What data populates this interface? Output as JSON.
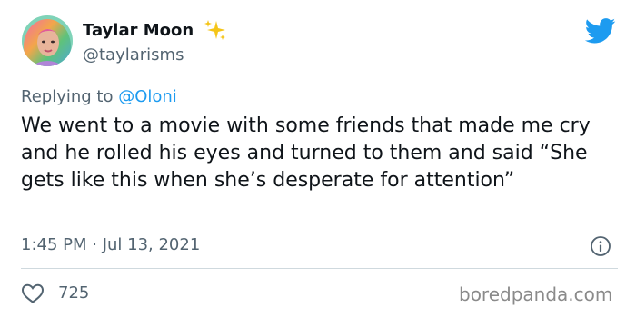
{
  "author": {
    "display_name": "Taylar Moon",
    "handle": "@taylarisms",
    "avatar_icon": "avatar-illustration",
    "badge_icon": "sparkle-icon"
  },
  "platform_icon": "twitter-bird-icon",
  "reply": {
    "prefix": "Replying to ",
    "mention": "@Oloni"
  },
  "tweet": {
    "text": "We went to a movie with some friends that made me cry and he rolled his eyes and turned to them and said “She gets like this when she’s desperate for attention”",
    "timestamp": "1:45 PM · Jul 13, 2021",
    "likes": "725"
  },
  "watermark": "boredpanda.com",
  "colors": {
    "text": "#0f1419",
    "secondary": "#536471",
    "accent": "#1d9bf0",
    "divider": "#cfd9de",
    "sparkle": "#f5c518"
  }
}
